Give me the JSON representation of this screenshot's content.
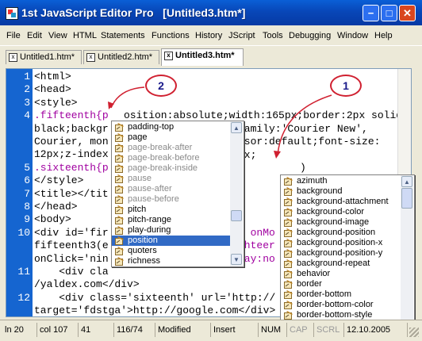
{
  "window": {
    "title": "1st JavaScript Editor Pro   [Untitled3.htm*]",
    "min_glyph": "−",
    "max_glyph": "□",
    "close_glyph": "✕"
  },
  "menu": [
    "File",
    "Edit",
    "View",
    "HTML",
    "Statements",
    "Functions",
    "History",
    "JScript",
    "Tools",
    "Debugging",
    "Window",
    "Help"
  ],
  "tabs": [
    {
      "label": "Untitled1.htm*",
      "active": false
    },
    {
      "label": "Untitled2.htm*",
      "active": false
    },
    {
      "label": "Untitled3.htm*",
      "active": true
    }
  ],
  "editor": {
    "lines": [
      {
        "n": "1",
        "text": "<html>"
      },
      {
        "n": "2",
        "text": "<head>"
      },
      {
        "n": "3",
        "text": "<style>"
      },
      {
        "n": "4",
        "text": ".fifteenth{p"
      },
      {
        "n": "",
        "text": "black;backgr"
      },
      {
        "n": "",
        "text": "Courier, mon"
      },
      {
        "n": "",
        "text": "12px;z-index"
      },
      {
        "n": "5",
        "text": ".sixteenth{p"
      },
      {
        "n": "6",
        "text": "</style>"
      },
      {
        "n": "7",
        "text": "<title></tit"
      },
      {
        "n": "8",
        "text": "</head>"
      },
      {
        "n": "9",
        "text": "<body>"
      },
      {
        "n": "10",
        "text": "<div id='fir"
      },
      {
        "n": "",
        "text": "fifteenth3(e"
      },
      {
        "n": "",
        "text": "onClick='nin"
      },
      {
        "n": "11",
        "text": "    <div cla"
      },
      {
        "n": "",
        "text": "/yaldex.com</div>"
      },
      {
        "n": "12",
        "text": "    <div class='sixteenth' url='http://"
      },
      {
        "n": "",
        "text": "target='fdstga'>http://google.com</div>"
      }
    ],
    "line4_rest": "osition:absolute;width:165px;border:2px solid",
    "line4b_rest": "family:'Courier New',",
    "line4c_rest": "rsor:default;font-size:",
    "line4d_rest": "px;",
    "line5_rest": ")",
    "line10_rest": "' onMo",
    "line10b_rest": "ghteer",
    "line10c_rest": "lay:no"
  },
  "popup1": {
    "items": [
      {
        "label": "padding-top",
        "state": "normal"
      },
      {
        "label": "page",
        "state": "normal"
      },
      {
        "label": "page-break-after",
        "state": "grey"
      },
      {
        "label": "page-break-before",
        "state": "grey"
      },
      {
        "label": "page-break-inside",
        "state": "grey"
      },
      {
        "label": "pause",
        "state": "grey"
      },
      {
        "label": "pause-after",
        "state": "grey"
      },
      {
        "label": "pause-before",
        "state": "grey"
      },
      {
        "label": "pitch",
        "state": "normal"
      },
      {
        "label": "pitch-range",
        "state": "normal"
      },
      {
        "label": "play-during",
        "state": "normal"
      },
      {
        "label": "position",
        "state": "selected"
      },
      {
        "label": "quoters",
        "state": "normal"
      },
      {
        "label": "richness",
        "state": "normal"
      }
    ]
  },
  "popup2": {
    "items": [
      {
        "label": "azimuth"
      },
      {
        "label": "background"
      },
      {
        "label": "background-attachment"
      },
      {
        "label": "background-color"
      },
      {
        "label": "background-image"
      },
      {
        "label": "background-position"
      },
      {
        "label": "background-position-x"
      },
      {
        "label": "background-position-y"
      },
      {
        "label": "background-repeat"
      },
      {
        "label": "behavior"
      },
      {
        "label": "border"
      },
      {
        "label": "border-bottom"
      },
      {
        "label": "border-bottom-color"
      },
      {
        "label": "border-bottom-style"
      }
    ]
  },
  "callouts": {
    "one": "1",
    "two": "2"
  },
  "status": {
    "line": "ln 20",
    "col": "col 107",
    "num": "41",
    "pos": "116/74",
    "modified": "Modified",
    "mode": "Insert",
    "numlock": "NUM",
    "caps": "CAP",
    "scrl": "SCRL",
    "date": "12.10.2005"
  },
  "colors": {
    "accent": "#316ac5",
    "gutter": "#1565d0",
    "callout_ring": "#d02030",
    "keyword": "#a000a0"
  }
}
